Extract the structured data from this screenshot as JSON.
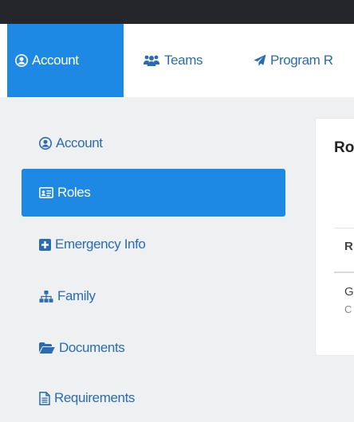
{
  "nav": {
    "tabs": [
      {
        "label": "Account",
        "icon": "user-circle-icon",
        "active": true
      },
      {
        "label": "Teams",
        "icon": "users-icon",
        "active": false
      },
      {
        "label": "Program R",
        "icon": "paper-plane-icon",
        "active": false
      }
    ]
  },
  "sidebar": {
    "items": [
      {
        "label": "Account",
        "icon": "user-circle-icon",
        "active": false
      },
      {
        "label": "Roles",
        "icon": "id-card-icon",
        "active": true
      },
      {
        "label": "Emergency Info",
        "icon": "plus-square-icon",
        "active": false
      },
      {
        "label": "Family",
        "icon": "sitemap-icon",
        "active": false
      },
      {
        "label": "Documents",
        "icon": "folder-open-icon",
        "active": false
      },
      {
        "label": "Requirements",
        "icon": "file-text-icon",
        "active": false
      }
    ]
  },
  "card": {
    "title": "Ro",
    "column_header": "R",
    "row_primary": "G",
    "row_secondary": "C"
  },
  "colors": {
    "accent": "#1e88e5",
    "link": "#2b6cb0",
    "topbar": "#24262b",
    "background": "#eef0f2"
  }
}
